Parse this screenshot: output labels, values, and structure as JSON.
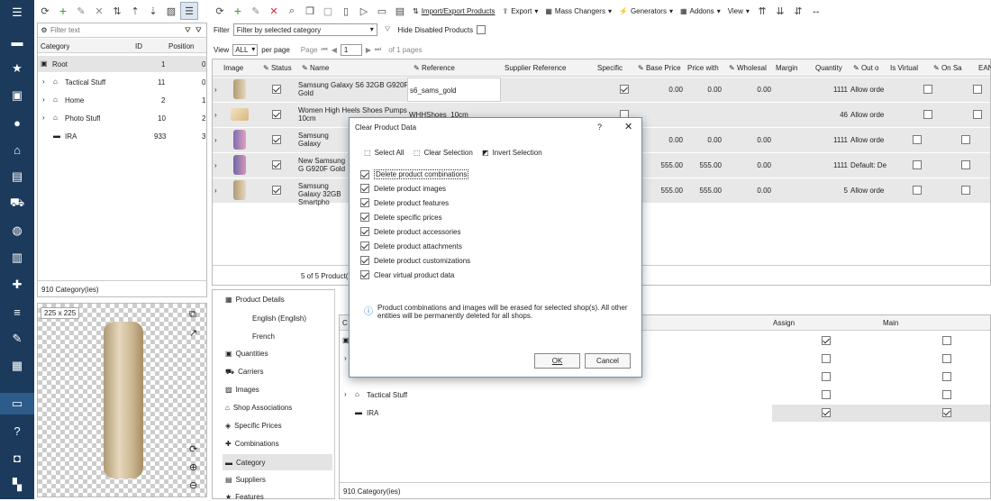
{
  "nav": {
    "icons": [
      "home-icon",
      "star-icon",
      "box-icon",
      "user-icon",
      "basket-icon",
      "chat-icon",
      "truck-icon",
      "globe-icon",
      "chart-icon",
      "puzzle-icon",
      "sliders-icon",
      "wrench-icon",
      "report-icon",
      "store-icon",
      "help-icon",
      "lock-icon",
      "cart-icon"
    ]
  },
  "toolbar": {
    "import_export": "Import/Export Products",
    "export": "Export",
    "mass_changers": "Mass Changers",
    "generators": "Generators",
    "addons": "Addons",
    "view": "View"
  },
  "filter": {
    "label": "Filter",
    "value": "Filter by selected category",
    "hide_disabled": "Hide Disabled Products"
  },
  "paging": {
    "view_label": "View",
    "view_value": "ALL",
    "per_page": "per page",
    "page_label": "Page",
    "page_value": "1",
    "of_pages": "of 1 pages"
  },
  "category_panel": {
    "filter_placeholder": "Filter text",
    "headers": [
      "Category",
      "ID",
      "Position"
    ],
    "rows": [
      {
        "name": "Root",
        "id": "1",
        "pos": "0"
      },
      {
        "name": "Tactical Stuff",
        "id": "11",
        "pos": "0"
      },
      {
        "name": "Home",
        "id": "2",
        "pos": "1"
      },
      {
        "name": "Photo Stuff",
        "id": "10",
        "pos": "2"
      },
      {
        "name": "IRA",
        "id": "933",
        "pos": "3"
      }
    ],
    "footer": "910 Category(ies)"
  },
  "image_preview": {
    "size_label": "225 x 225"
  },
  "grid": {
    "headers": [
      "Image",
      "Status",
      "Name",
      "Reference",
      "Supplier Reference",
      "Specific",
      "Base Price",
      "Price with",
      "Wholesal",
      "Margin",
      "Quantity",
      "Out o",
      "Is Virtual",
      "On Sa",
      "EAN"
    ],
    "rows": [
      {
        "name": "Samsung Galaxy S6 32GB G920F Gold",
        "ref": "s6_sams_gold",
        "base": "0.00",
        "pwith": "0.00",
        "whole": "0.00",
        "qty": "1111",
        "out": "Allow orde"
      },
      {
        "name": "Women High Heels Shoes Pumps 10cm",
        "ref": "WHHShoes_10cm",
        "base": "",
        "pwith": "",
        "whole": "",
        "qty": "46",
        "out": "Allow orde"
      },
      {
        "name": "Samsung Galaxy",
        "ref": "",
        "base": "0.00",
        "pwith": "0.00",
        "whole": "0.00",
        "qty": "1111",
        "out": "Allow orde"
      },
      {
        "name": "New Samsung G G920F Gold",
        "ref": "",
        "base": "555.00",
        "pwith": "555.00",
        "whole": "0.00",
        "qty": "1111",
        "out": "Default: De"
      },
      {
        "name": "Samsung Galaxy 32GB Smartpho",
        "ref": "",
        "base": "555.00",
        "pwith": "555.00",
        "whole": "0.00",
        "qty": "5",
        "out": "Allow orde"
      }
    ],
    "footer": "5 of 5 Product("
  },
  "details_tree": {
    "items": [
      "Product Details",
      "English (English)",
      "French",
      "Quantities",
      "Carriers",
      "Images",
      "Shop Associations",
      "Specific Prices",
      "Combinations",
      "Category",
      "Suppliers",
      "Features"
    ]
  },
  "assign_panel": {
    "headers": [
      "C",
      "Assign",
      "Main"
    ],
    "rows": [
      "",
      "",
      "",
      "Tactical Stuff",
      "IRA"
    ],
    "footer": "910 Category(ies)"
  },
  "dialog": {
    "title": "Clear Product Data",
    "help": "?",
    "select_all": "Select All",
    "clear_selection": "Clear Selection",
    "invert_selection": "Invert Selection",
    "options": [
      "Delete product combinations",
      "Delete product images",
      "Delete product features",
      "Delete specific prices",
      "Delete product accessories",
      "Delete product attachments",
      "Delete product customizations",
      "Clear virtual product data"
    ],
    "info": "Product combinations and images will be erased for selected shop(s). All other entities will be permanently deleted for all shops.",
    "ok": "OK",
    "cancel": "Cancel"
  },
  "colors": {
    "nav_bg": "#1b3a5c",
    "accent_green": "#2e9e3e",
    "accent_red": "#d9262c",
    "info_blue": "#2a6ebb"
  }
}
